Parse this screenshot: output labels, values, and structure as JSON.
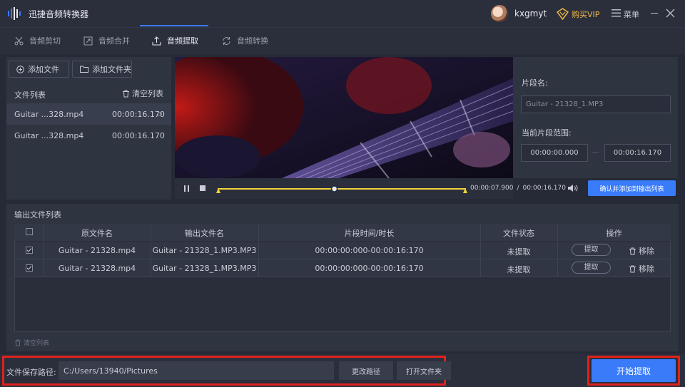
{
  "app": {
    "title": "迅捷音频转换器"
  },
  "user": {
    "name": "kxgmyt",
    "vip_label": "购买VIP",
    "menu_label": "菜单"
  },
  "tabs": [
    {
      "label": "音频剪切",
      "icon": "scissors-icon"
    },
    {
      "label": "音频合并",
      "icon": "merge-icon"
    },
    {
      "label": "音频提取",
      "icon": "extract-icon",
      "active": true
    },
    {
      "label": "音频转换",
      "icon": "convert-icon"
    }
  ],
  "file_panel": {
    "add_file": "添加文件",
    "add_folder": "添加文件夹",
    "list_header": "文件列表",
    "clear_list": "清空列表",
    "files": [
      {
        "name": "Guitar ...328.mp4",
        "duration": "00:00:16.170"
      },
      {
        "name": "Guitar ...328.mp4",
        "duration": "00:00:16.170"
      }
    ]
  },
  "player": {
    "current_time": "00:00:07.900",
    "separator": "/",
    "total_time": "00:00:16.170",
    "progress": 0.47
  },
  "segment": {
    "name_label": "片段名:",
    "name_placeholder": "Guitar - 21328_1.MP3",
    "range_label": "当前片段范围:",
    "start": "00:00:00.000",
    "dash": "—",
    "end": "00:00:16.170",
    "confirm_button": "确认并添加到输出列表"
  },
  "output": {
    "title": "输出文件列表",
    "columns": [
      "原文件名",
      "输出文件名",
      "片段时间/时长",
      "文件状态",
      "操作"
    ],
    "rows": [
      {
        "source": "Guitar - 21328.mp4",
        "output": "Guitar - 21328_1.MP3.MP3",
        "time": "00:00:00:000-00:00:16:170",
        "status": "未提取",
        "extract": "提取",
        "remove": "移除"
      },
      {
        "source": "Guitar - 21328.mp4",
        "output": "Guitar - 21328_1.MP3.MP3",
        "time": "00:00:00:000-00:00:16:170",
        "status": "未提取",
        "extract": "提取",
        "remove": "移除"
      }
    ],
    "clear_list": "清空列表"
  },
  "bottom": {
    "path_label": "文件保存路径:",
    "path_value": "C:/Users/13940/Pictures",
    "change_path": "更改路径",
    "open_folder": "打开文件夹",
    "start_button": "开始提取"
  },
  "colors": {
    "accent": "#3a7bfa",
    "highlight": "#e0221b",
    "timeline": "#f2d43a"
  }
}
